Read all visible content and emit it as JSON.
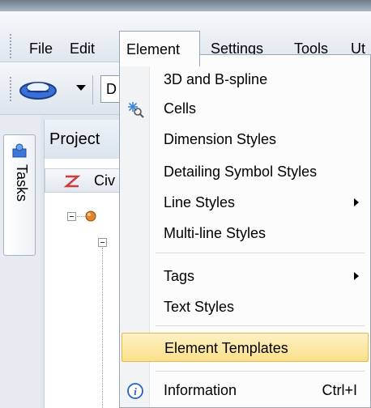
{
  "menubar": {
    "items": [
      {
        "label": "File"
      },
      {
        "label": "Edit"
      },
      {
        "label": "Element"
      },
      {
        "label": "Settings"
      },
      {
        "label": "Tools"
      },
      {
        "label": "Ut"
      }
    ]
  },
  "toolbar": {
    "combo_text": "D"
  },
  "left_tabs": {
    "tasks_label": "Tasks"
  },
  "panel": {
    "title": "Project",
    "toolbar_label": "Civ"
  },
  "element_menu": {
    "items": [
      {
        "label": "3D and B-spline",
        "icon": "",
        "submenu": false
      },
      {
        "label": "Cells",
        "icon": "cells-icon",
        "submenu": false
      },
      {
        "label": "Dimension Styles",
        "icon": "",
        "submenu": false
      },
      {
        "label": "Detailing Symbol Styles",
        "icon": "",
        "submenu": false
      },
      {
        "label": "Line Styles",
        "icon": "",
        "submenu": true
      },
      {
        "label": "Multi-line Styles",
        "icon": "",
        "submenu": false
      },
      {
        "label": "Tags",
        "icon": "",
        "submenu": true
      },
      {
        "label": "Text Styles",
        "icon": "",
        "submenu": false
      },
      {
        "label": "Element Templates",
        "icon": "",
        "submenu": false,
        "highlighted": true
      },
      {
        "label": "Information",
        "icon": "info-icon",
        "submenu": false,
        "shortcut": "Ctrl+I"
      }
    ]
  },
  "colors": {
    "highlight_top": "#fdf1c4",
    "highlight_bottom": "#fbe08a",
    "highlight_border": "#e7b850",
    "menu_background": "#fcfcfc",
    "info_icon_blue": "#2a62c9"
  }
}
